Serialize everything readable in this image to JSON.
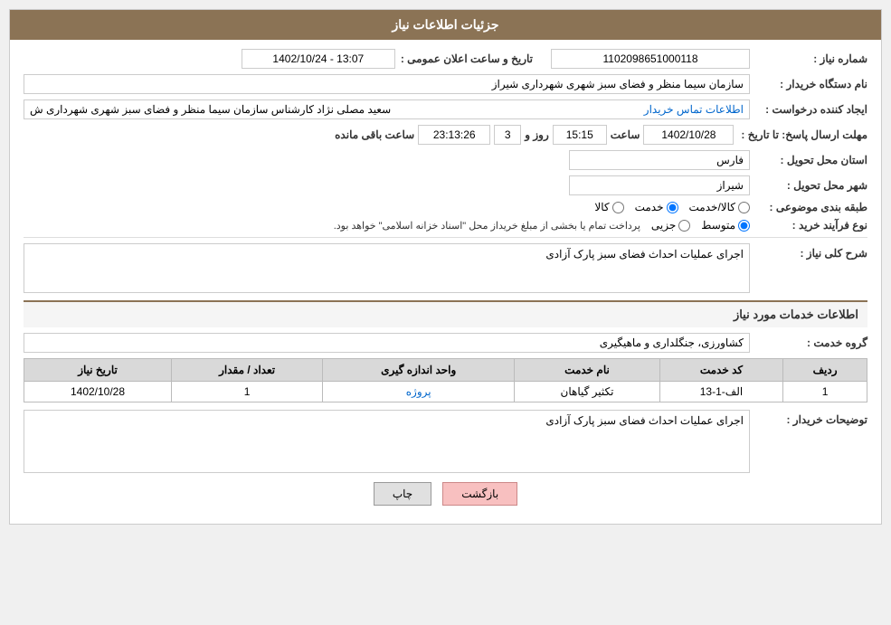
{
  "page": {
    "title": "جزئیات اطلاعات نیاز"
  },
  "header": {
    "announcement_number_label": "شماره نیاز :",
    "announcement_number_value": "1102098651000118",
    "announcement_datetime_label": "تاریخ و ساعت اعلان عمومی :",
    "announcement_datetime_value": "1402/10/24 - 13:07",
    "buyer_name_label": "نام دستگاه خریدار :",
    "buyer_name_value": "سازمان سیما منظر و فضای سبز شهری شهرداری شیراز",
    "creator_label": "ایجاد کننده درخواست :",
    "creator_name": "سعید مصلی نژاد کارشناس سازمان سیما منظر و فضای سبز شهری شهرداری ش",
    "creator_link": "اطلاعات تماس خریدار",
    "deadline_label": "مهلت ارسال پاسخ: تا تاریخ :",
    "deadline_date": "1402/10/28",
    "deadline_time_label": "ساعت",
    "deadline_time": "15:15",
    "deadline_day_label": "روز و",
    "deadline_days": "3",
    "deadline_remaining_label": "ساعت باقی مانده",
    "deadline_remaining": "23:13:26",
    "province_label": "استان محل تحویل :",
    "province_value": "فارس",
    "city_label": "شهر محل تحویل :",
    "city_value": "شیراز",
    "category_label": "طبقه بندی موضوعی :",
    "category_options": [
      {
        "label": "کالا",
        "value": "kala"
      },
      {
        "label": "خدمت",
        "value": "khedmat"
      },
      {
        "label": "کالا/خدمت",
        "value": "kala_khedmat"
      }
    ],
    "category_selected": "khedmat",
    "purchase_type_label": "نوع فرآیند خرید :",
    "purchase_type_options": [
      {
        "label": "جزیی",
        "value": "jozi"
      },
      {
        "label": "متوسط",
        "value": "motevaset"
      }
    ],
    "purchase_type_selected": "motevaset",
    "purchase_note": "پرداخت تمام یا بخشی از مبلغ خریداز محل \"اسناد خزانه اسلامی\" خواهد بود."
  },
  "need_description": {
    "section_label": "شرح کلی نیاز :",
    "value": "اجرای عملیات احداث فضای سبز پارک آزادی"
  },
  "services_section": {
    "title": "اطلاعات خدمات مورد نیاز",
    "service_group_label": "گروه خدمت :",
    "service_group_value": "کشاورزی، جنگلداری و ماهیگیری",
    "table": {
      "columns": [
        "ردیف",
        "کد خدمت",
        "نام خدمت",
        "واحد اندازه گیری",
        "تعداد / مقدار",
        "تاریخ نیاز"
      ],
      "rows": [
        {
          "row_num": "1",
          "service_code": "الف-1-13",
          "service_name": "تکثیر گیاهان",
          "unit": "پروژه",
          "quantity": "1",
          "date": "1402/10/28"
        }
      ]
    }
  },
  "buyer_desc": {
    "label": "توضیحات خریدار :",
    "value": "اجرای عملیات احداث فضای سبز پارک آزادی"
  },
  "buttons": {
    "print": "چاپ",
    "back": "بازگشت"
  }
}
